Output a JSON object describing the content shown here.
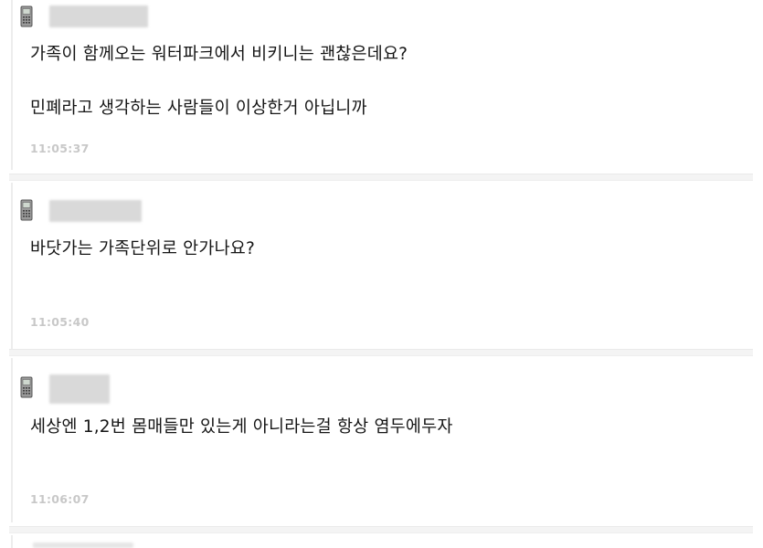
{
  "comments": [
    {
      "icon": "mobile-phone-icon",
      "author_hidden": true,
      "lines": [
        "가족이 함께오는 워터파크에서 비키니는 괜찮은데요?",
        "민폐라고 생각하는 사람들이 이상한거 아닙니까"
      ],
      "time": "11:05:37"
    },
    {
      "icon": "mobile-phone-icon",
      "author_hidden": true,
      "lines": [
        "바닷가는 가족단위로 안가나요?"
      ],
      "time": "11:05:40"
    },
    {
      "icon": "mobile-phone-icon",
      "author_hidden": true,
      "lines": [
        "세상엔 1,2번 몸매들만 있는게 아니라는걸 항상 염두에두자"
      ],
      "time": "11:06:07"
    }
  ],
  "colors": {
    "text": "#151515",
    "timestamp": "#c8c8c8",
    "separator": "#f4f4f4",
    "blur_name": "#d9d9d9"
  }
}
